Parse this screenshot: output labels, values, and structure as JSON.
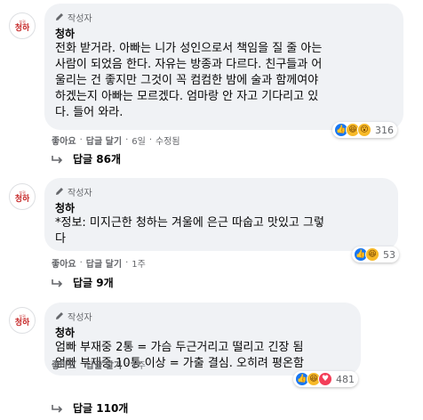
{
  "comments": [
    {
      "avatar_top": "부귀",
      "avatar_main": "청하",
      "badge": "작성자",
      "author": "청하",
      "text": "전화 받거라. 아빠는 니가 성인으로서 책임을 질 줄 아는\n사람이 되었음 한다. 자유는 방종과 다르다. 친구들과 어\n울리는 건 좋지만 그것이 꼭 컴컴한 밤에 술과 함께여야\n하겠는지 아빠는 모르겠다. 엄마랑 안 자고 기다리고 있\n다. 들어 와라.",
      "like": "좋아요",
      "reply": "답글 달기",
      "time": "6일",
      "edited": "수정됨",
      "reactions": [
        "like",
        "haha",
        "wow"
      ],
      "reaction_count": "316",
      "replies_label": "답글 86개"
    },
    {
      "avatar_top": "부귀",
      "avatar_main": "청하",
      "badge": "작성자",
      "author": "청하",
      "text": "*정보: 미지근한 청하는 겨울에 은근 따숩고 맛있고 그렇\n다",
      "like": "좋아요",
      "reply": "답글 달기",
      "time": "1주",
      "reactions": [
        "like",
        "haha"
      ],
      "reaction_count": "53",
      "replies_label": "답글 9개"
    },
    {
      "avatar_top": "부귀",
      "avatar_main": "청하",
      "badge": "작성자",
      "author": "청하",
      "text": "엄빠 부재중 2통 = 가슴 두근거리고 떨리고 긴장 됨\n엄빠 부재중 10통 이상 = 가출 결심. 오히려 평온함",
      "like": "좋아요",
      "reply": "답글 달기",
      "time": "1주",
      "reactions": [
        "like",
        "haha",
        "love"
      ],
      "reaction_count": "481",
      "replies_label": "답글 110개"
    }
  ],
  "colors": {
    "bubble": "#f0f2f5",
    "meta": "#65676b",
    "like_blue": "#1877f2",
    "love_red": "#f33e58",
    "haha_yellow": "#f7b928"
  }
}
